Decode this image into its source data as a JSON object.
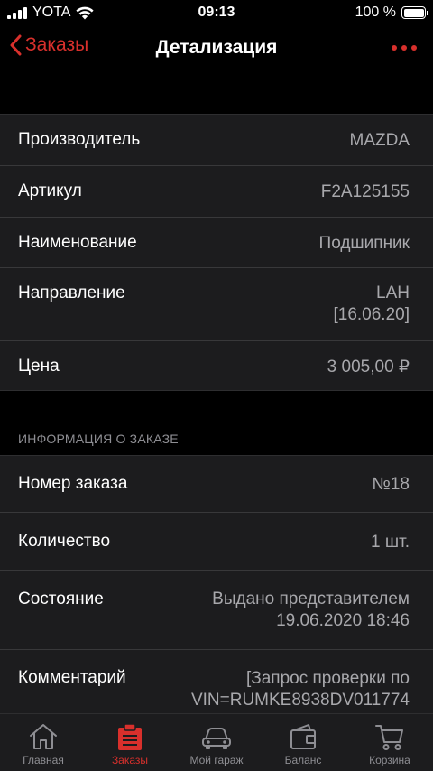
{
  "status_bar": {
    "carrier": "YOTA",
    "time": "09:13",
    "battery": "100 %"
  },
  "nav": {
    "back_label": "Заказы",
    "title": "Детализация"
  },
  "details": [
    {
      "label": "Производитель",
      "value": "MAZDA"
    },
    {
      "label": "Артикул",
      "value": "F2A125155"
    },
    {
      "label": "Наименование",
      "value": "Подшипник"
    },
    {
      "label": "Направление",
      "value_line1": "LAH",
      "value_line2": "[16.06.20]"
    },
    {
      "label": "Цена",
      "value": "3 005,00 ₽"
    }
  ],
  "order_section": {
    "header": "ИНФОРМАЦИЯ О ЗАКАЗЕ",
    "rows": [
      {
        "label": "Номер заказа",
        "value": "№18"
      },
      {
        "label": "Количество",
        "value": "1 шт."
      },
      {
        "label": "Состояние",
        "value_line1": "Выдано представителем",
        "value_line2": "19.06.2020 18:46"
      },
      {
        "label": "Комментарий",
        "value_line1": "[Запрос проверки по",
        "value_line2": "VIN=RUMKE8938DV011774"
      }
    ]
  },
  "tabs": [
    {
      "label": "Главная",
      "icon": "home-icon"
    },
    {
      "label": "Заказы",
      "icon": "orders-icon"
    },
    {
      "label": "Мой гараж",
      "icon": "car-icon"
    },
    {
      "label": "Баланс",
      "icon": "wallet-icon"
    },
    {
      "label": "Корзина",
      "icon": "cart-icon"
    }
  ],
  "colors": {
    "accent": "#d8302c",
    "cell_bg": "#1c1c1e",
    "secondary_text": "#a8a8ac"
  }
}
